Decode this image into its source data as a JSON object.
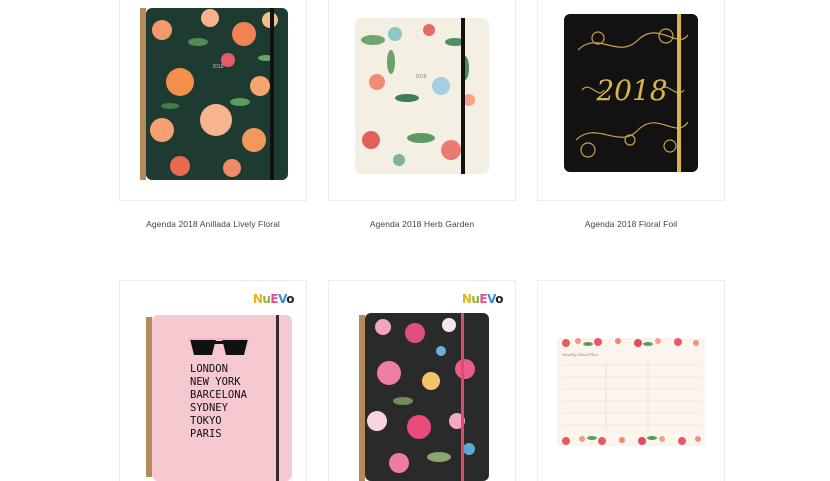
{
  "badge": {
    "parts": [
      "N",
      "u",
      "E",
      "V",
      "o"
    ]
  },
  "products": [
    {
      "title": "Agenda 2018 Anillada Lively Floral",
      "year": "2018",
      "cover_color": "#1d3b31",
      "band_color": "#111111",
      "has_badge": true
    },
    {
      "title": "Agenda 2018 Herb Garden",
      "year": "2018",
      "cover_color": "#f3efe3",
      "band_color": "#111111",
      "has_badge": true
    },
    {
      "title": "Agenda 2018 Floral Foil",
      "year": "2018",
      "cover_color": "#121212",
      "band_color": "#d9b64b",
      "has_badge": true
    },
    {
      "title": "",
      "cover_color": "#f6c9d0",
      "band_color": "#3a2a2a",
      "has_badge": true,
      "cities": [
        "LONDON",
        "NEW YORK",
        "BARCELONA",
        "SYDNEY",
        "TOKYO",
        "PARIS"
      ]
    },
    {
      "title": "",
      "cover_color": "#2a2a2a",
      "band_color": "#e24a6a",
      "has_badge": true
    },
    {
      "title": "",
      "cover_color": "#fbf5ee",
      "band_color": "",
      "has_badge": false,
      "note_title": "Weekly Meal Plan"
    }
  ]
}
